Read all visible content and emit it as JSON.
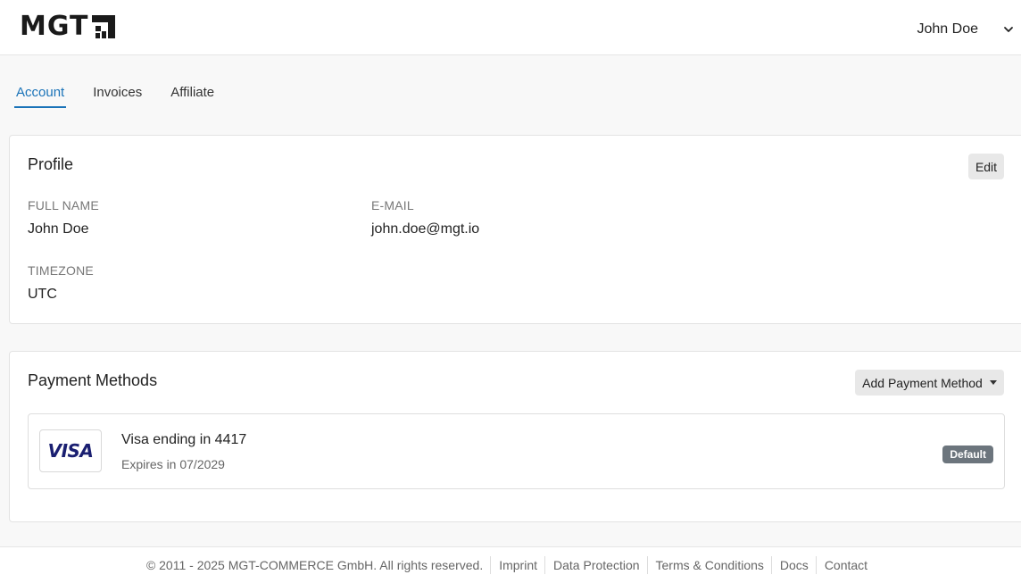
{
  "header": {
    "logo_text": "MGT",
    "user_name": "John Doe"
  },
  "tabs": [
    {
      "label": "Account",
      "active": true
    },
    {
      "label": "Invoices",
      "active": false
    },
    {
      "label": "Affiliate",
      "active": false
    }
  ],
  "profile": {
    "title": "Profile",
    "edit_label": "Edit",
    "full_name_label": "FULL NAME",
    "full_name_value": "John Doe",
    "email_label": "E-MAIL",
    "email_value": "john.doe@mgt.io",
    "timezone_label": "TIMEZONE",
    "timezone_value": "UTC"
  },
  "payment": {
    "title": "Payment Methods",
    "add_label": "Add Payment Method",
    "methods": [
      {
        "brand": "VISA",
        "title": "Visa ending in 4417",
        "expires": "Expires in 07/2029",
        "badge": "Default"
      }
    ]
  },
  "footer": {
    "copyright": "© 2011 - 2025 MGT-COMMERCE GmbH. All rights reserved.",
    "links": [
      "Imprint",
      "Data Protection",
      "Terms & Conditions",
      "Docs",
      "Contact"
    ]
  },
  "colors": {
    "accent": "#1a73b8",
    "badge": "#6c757d",
    "visa": "#1a1f71"
  }
}
